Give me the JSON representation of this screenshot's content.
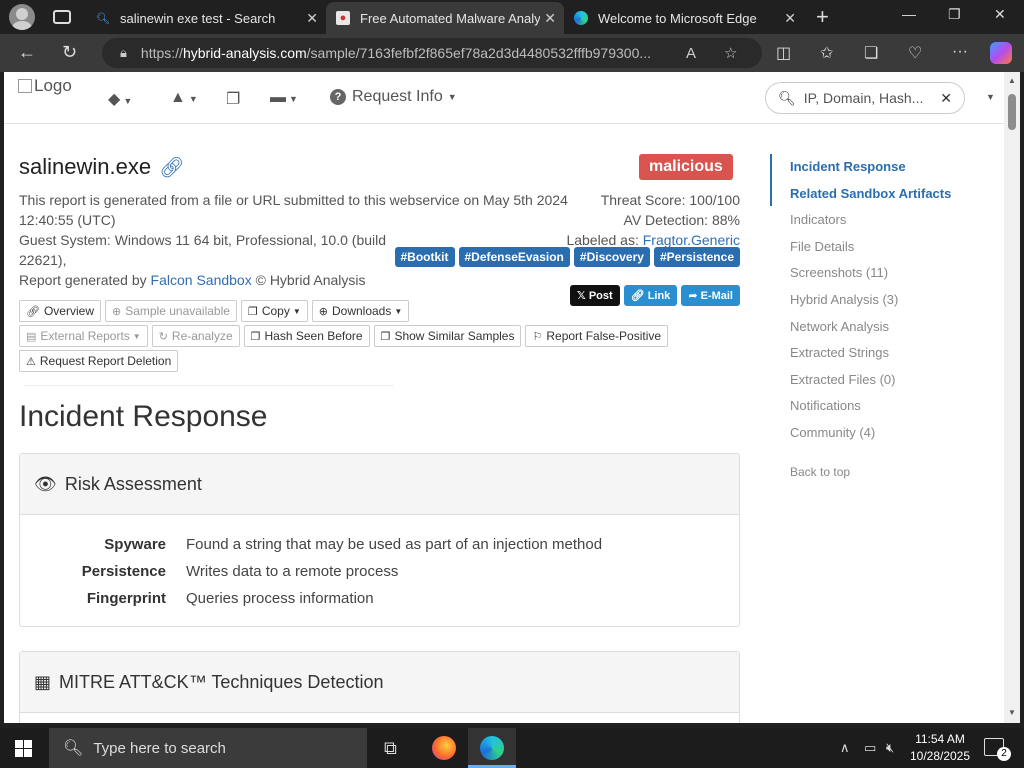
{
  "browser": {
    "tabs": [
      {
        "title": "salinewin exe test - Search",
        "active": false
      },
      {
        "title": "Free Automated Malware Analysis",
        "active": true
      },
      {
        "title": "Welcome to Microsoft Edge",
        "active": false
      }
    ],
    "url_scheme": "https://",
    "url_host": "hybrid-analysis.com",
    "url_path": "/sample/7163fefbf2f865ef78a2d3d4480532fffb979300..."
  },
  "site": {
    "logo_alt": "Logo",
    "request_info_label": "Request Info",
    "search_placeholder": "IP, Domain, Hash..."
  },
  "report": {
    "filename": "salinewin.exe",
    "verdict": "malicious",
    "line1": "This report is generated from a file or URL submitted to this webservice on May 5th 2024 12:40:55 (UTC)",
    "line2": "Guest System: Windows 11 64 bit, Professional, 10.0 (build 22621),",
    "line3_pre": "Report generated by ",
    "line3_link": "Falcon Sandbox",
    "line3_post": " © Hybrid Analysis",
    "threat_score": "Threat Score: 100/100",
    "av_detection": "AV Detection: 88%",
    "labeled_as_pre": "Labeled as: ",
    "labeled_as": "Fragtor.Generic",
    "tags": [
      "#Bootkit",
      "#DefenseEvasion",
      "#Discovery",
      "#Persistence"
    ],
    "share": {
      "post": "Post",
      "link": "Link",
      "email": "E-Mail"
    }
  },
  "actions": {
    "row1": [
      "Overview",
      "Sample unavailable",
      "Copy",
      "Downloads"
    ],
    "row2": [
      "External Reports",
      "Re-analyze",
      "Hash Seen Before",
      "Show Similar Samples",
      "Report False-Positive"
    ],
    "row3": [
      "Request Report Deletion"
    ]
  },
  "incident": {
    "heading": "Incident Response",
    "risk_title": "Risk Assessment",
    "risks": [
      {
        "k": "Spyware",
        "v": "Found a string that may be used as part of an injection method"
      },
      {
        "k": "Persistence",
        "v": "Writes data to a remote process"
      },
      {
        "k": "Fingerprint",
        "v": "Queries process information"
      }
    ],
    "mitre_title": "MITRE ATT&CK™ Techniques Detection"
  },
  "sidenav": {
    "items": [
      "Incident Response",
      "Related Sandbox Artifacts",
      "Indicators",
      "File Details",
      "Screenshots (11)",
      "Hybrid Analysis (3)",
      "Network Analysis",
      "Extracted Strings",
      "Extracted Files (0)",
      "Notifications",
      "Community (4)"
    ],
    "back_to_top": "Back to top"
  },
  "taskbar": {
    "search_placeholder": "Type here to search",
    "time": "11:54 AM",
    "date": "10/28/2025",
    "notifications": "2"
  },
  "colors": {
    "accent": "#2a6eb0",
    "malicious": "#d9534f",
    "x_black": "#111111"
  }
}
